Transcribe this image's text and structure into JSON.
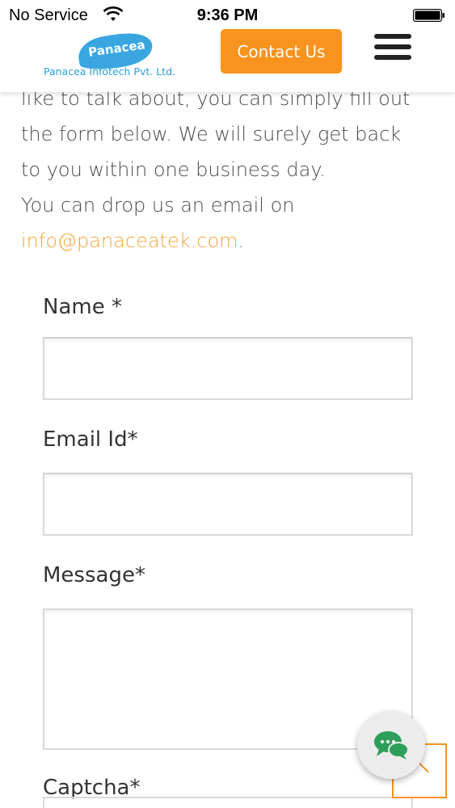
{
  "status_bar": {
    "carrier": "No Service",
    "time": "9:36 PM",
    "wifi_icon": "wifi-icon",
    "battery_icon": "battery-icon"
  },
  "header": {
    "logo_word": "Panacea",
    "logo_tagline": "Panacea Infotech Pvt. Ltd.",
    "contact_button": "Contact Us",
    "menu_icon": "hamburger-menu-icon",
    "accent_color": "#f7931e",
    "brand_color": "#2a9fd8"
  },
  "intro": {
    "line1": "like to talk about, you can simply fill out",
    "line2": "the form below. We will surely get back",
    "line3": "to you within one business day.",
    "line4": "You can drop us an email on",
    "email": "info@panaceatek.com",
    "email_suffix": "."
  },
  "form": {
    "name_label": "Name *",
    "email_label": "Email Id*",
    "message_label": "Message*",
    "captcha_label": "Captcha*",
    "name_value": "",
    "email_value": "",
    "message_value": ""
  },
  "floating": {
    "chat_icon": "chat-bubbles-icon",
    "top_icon": "chevron-up-icon"
  }
}
